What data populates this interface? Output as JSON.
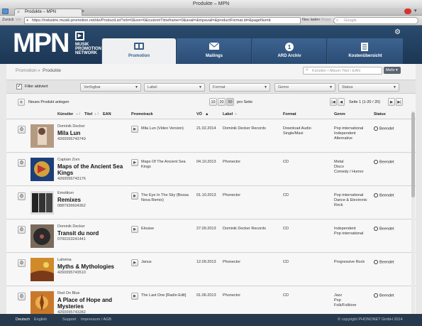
{
  "window": {
    "title": "Produkte – MPN",
    "tab_label": "Produkte – MPN"
  },
  "toolbar": {
    "back": "Zurück",
    "forward": "Vor",
    "url": "https://industrie.musik-promotion.net/de/ProductList?srb=0&sre=0&customTimeframe=0&avail=&mpavail=&productFormat.id=&pageNumb",
    "reload": "Neu laden",
    "stop": "Stopp",
    "search_placeholder": "Google"
  },
  "logo": {
    "big": "MPN",
    "line1": "MUSIK",
    "line2": "PROMOTION",
    "line3": "NETWORK"
  },
  "nav": [
    {
      "label": "Promotion",
      "active": true
    },
    {
      "label": "Mailings"
    },
    {
      "label": "ARD Archiv"
    },
    {
      "label": "Kostenübersicht"
    }
  ],
  "breadcrumb": {
    "root": "Promotion",
    "sep": "»",
    "current": "Produkte"
  },
  "search": {
    "placeholder": "Künstler / Album-Titel / EAN",
    "more": "Mehr"
  },
  "filters": {
    "active_label": "Filter aktiviert",
    "selects": [
      "Verfügbar",
      "Label",
      "Format",
      "Genre",
      "Status"
    ]
  },
  "actions": {
    "new_product": "Neues Produkt anlegen",
    "page_sizes": [
      "10",
      "20",
      "50"
    ],
    "per_page": "pro Seite",
    "page_info": "Seite 1 (1-20 / 20)"
  },
  "columns": {
    "artist": "Künstler",
    "title": "Titel",
    "ean": "EAN",
    "promotrack": "Promotrack",
    "vo": "VÖ",
    "label": "Label",
    "format": "Format",
    "genre": "Genre",
    "status": "Status"
  },
  "rows": [
    {
      "artist": "Dominik Decker",
      "title": "Mila Lun",
      "ean": "4260095743749",
      "track": "Mila Lun (Video Version)",
      "date": "21.02.2014",
      "label": "Dominik Decker Records",
      "format": "Download Audio\nSingle/Maxi",
      "genre": "Pop international\nIndependent\nAlternative",
      "status": "Beendet"
    },
    {
      "artist": "Captain Zorx",
      "title": "Maps of the Ancient Sea Kings",
      "ean": "4260095743176",
      "track": "Maps Of The Ancient Sea\nKings",
      "date": "04.10.2013",
      "label": "Phonector",
      "format": "CD",
      "genre": "Metal\nDisco\nComedy / Humor",
      "status": "Beendet"
    },
    {
      "artist": "Emotikon",
      "title": "Remixes",
      "ean": "0887936604362",
      "track": "The Eye In The Sky (Bossa\nNova Remix)",
      "date": "01.10.2013",
      "label": "Phonector",
      "format": "CD",
      "genre": "Pop international\nDance & Electronic\nRock",
      "status": "Beendet"
    },
    {
      "artist": "Dominik Decker",
      "title": "Transit du nord",
      "ean": "0700153241441",
      "track": "Elouise",
      "date": "27.09.2013",
      "label": "Dominik Decker Records",
      "format": "CD",
      "genre": "Independent\nPop international",
      "status": "Beendet"
    },
    {
      "artist": "Laheina",
      "title": "Myths & Mythologies",
      "ean": "4260095743510",
      "track": "Janus",
      "date": "12.09.2013",
      "label": "Phonector",
      "format": "CD",
      "genre": "Progressive Rock",
      "status": "Beendet"
    },
    {
      "artist": "Red On Blue",
      "title": "A Place of Hope and Mysteries",
      "ean": "4260095743282",
      "track": "The Last One [Radio Edit]",
      "date": "01.06.2013",
      "label": "Phonector",
      "format": "CD",
      "genre": "Jazz\nPop\nFolk/Folklore",
      "status": "Beendet"
    }
  ],
  "footer": {
    "lang_de": "Deutsch",
    "lang_en": "English",
    "support": "Support",
    "impressum": "Impressum / AGB",
    "copyright": "© copyright PHONONET GmbH 2014"
  },
  "colors": {
    "header": "#1f3a5a",
    "footer": "#27394c",
    "accent": "#3b5e86"
  }
}
